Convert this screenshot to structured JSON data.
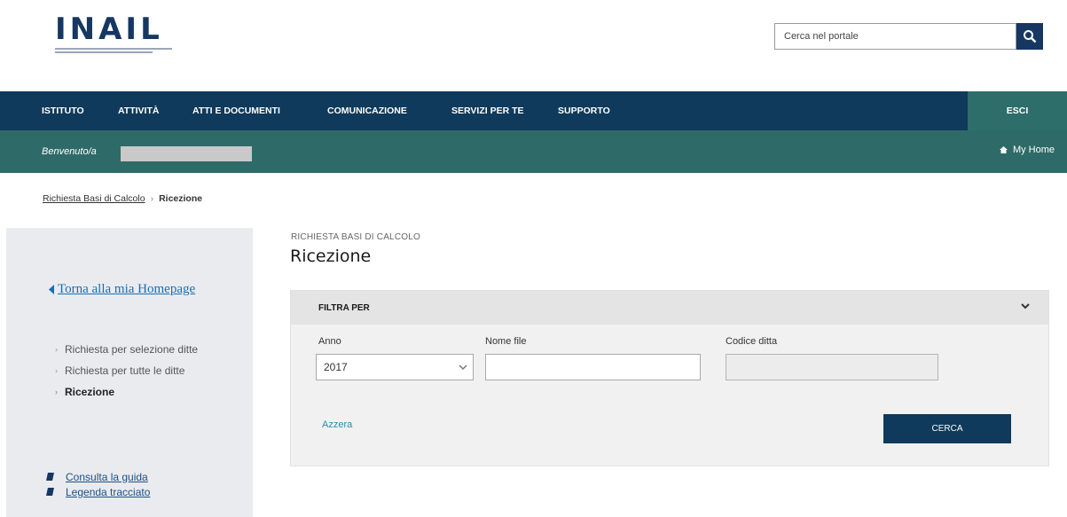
{
  "header": {
    "logo_text": "INAIL",
    "search_placeholder": "Cerca nel portale"
  },
  "nav": {
    "items": [
      "ISTITUTO",
      "ATTIVITÀ",
      "ATTI E DOCUMENTI",
      "COMUNICAZIONE",
      "SERVIZI PER TE",
      "SUPPORTO"
    ],
    "logout": "ESCI"
  },
  "welcome": {
    "label": "Benvenuto/a",
    "my_home": "My Home"
  },
  "breadcrumb": {
    "parent": "Richiesta Basi di Calcolo",
    "current": "Ricezione"
  },
  "sidebar": {
    "back_link": "Torna alla mia Homepage",
    "menu": [
      "Richiesta per selezione ditte",
      "Richiesta per tutte le ditte",
      "Ricezione"
    ],
    "links": [
      "Consulta la guida",
      "Legenda tracciato"
    ]
  },
  "main": {
    "section_label": "RICHIESTA BASI DI CALCOLO",
    "title": "Ricezione"
  },
  "filter": {
    "title": "FILTRA PER",
    "anno_label": "Anno",
    "anno_value": "2017",
    "nome_file_label": "Nome file",
    "nome_file_value": "",
    "codice_ditta_label": "Codice ditta",
    "codice_ditta_value": "",
    "reset": "Azzera",
    "submit": "CERCA"
  },
  "colors": {
    "nav_bg": "#0f3a5b",
    "welcome_bg": "#2e6b68",
    "logo": "#163761",
    "link": "#1c6db0"
  }
}
